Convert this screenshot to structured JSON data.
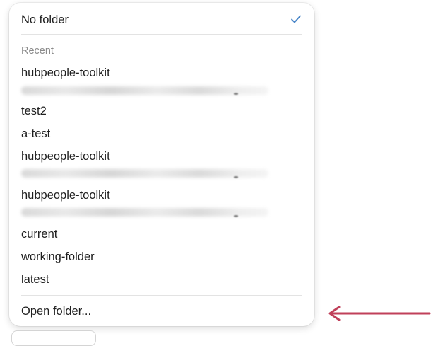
{
  "menu": {
    "no_folder_label": "No folder",
    "selected_icon": "checkmark-icon",
    "recent_header": "Recent",
    "recent_items": [
      "hubpeople-toolkit",
      "test2",
      "a-test",
      "hubpeople-toolkit",
      "hubpeople-toolkit",
      "current",
      "working-folder",
      "latest"
    ],
    "open_folder_label": "Open folder..."
  },
  "annotation": {
    "icon": "arrow-left-icon",
    "color": "#c0405a"
  },
  "colors": {
    "accent": "#4a86c8",
    "divider": "#e3e3e3",
    "header_text": "#8b8b8b"
  }
}
